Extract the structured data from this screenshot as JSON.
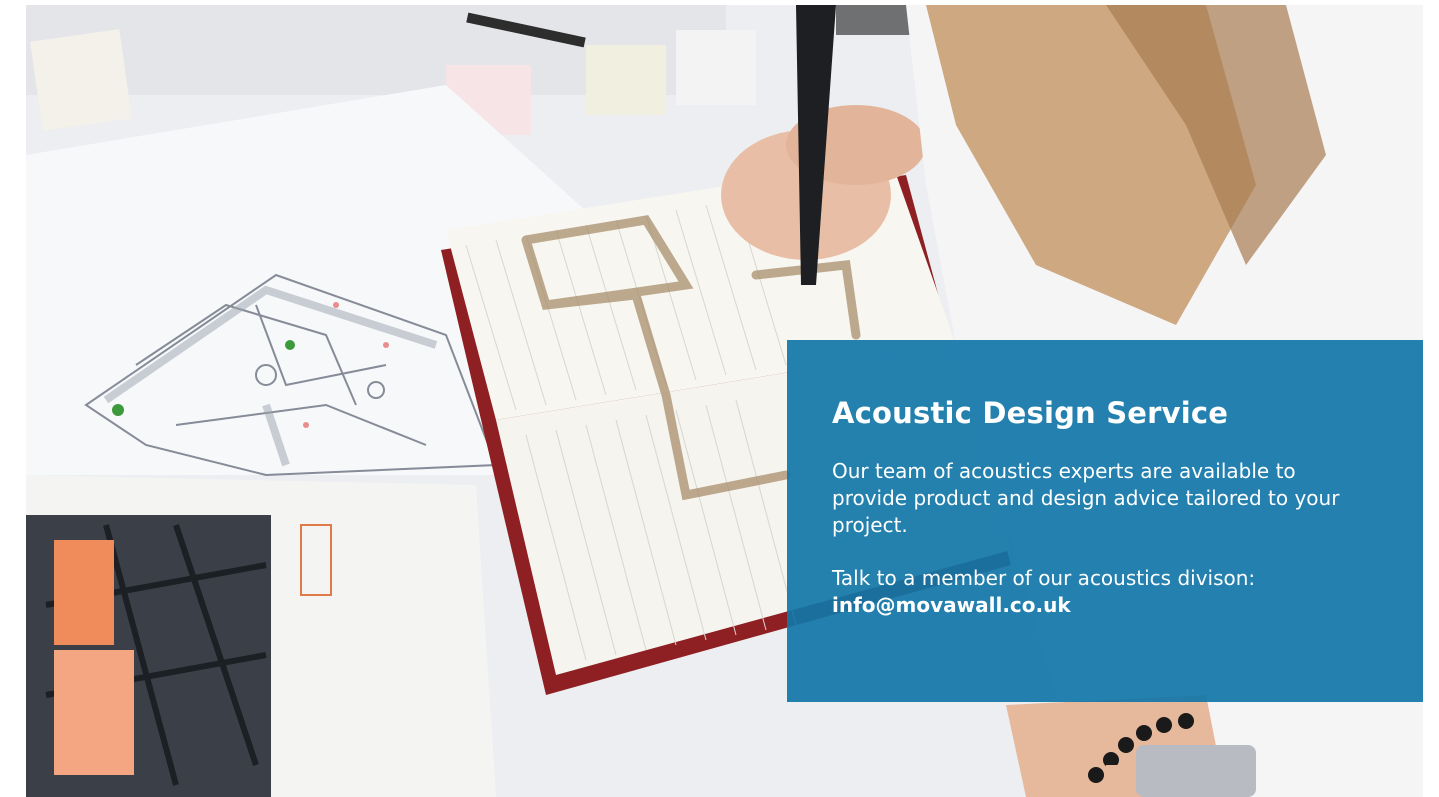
{
  "hero": {
    "image_description_icon": "architect-drawing-photo"
  },
  "card": {
    "title": "Acoustic Design Service",
    "body": "Our team of acoustics experts are available to provide product and design advice tailored to your project.",
    "contact_prompt": "Talk to a member of our acoustics divison:",
    "email": "info@movawall.co.uk",
    "background_color": "#1176A8"
  }
}
